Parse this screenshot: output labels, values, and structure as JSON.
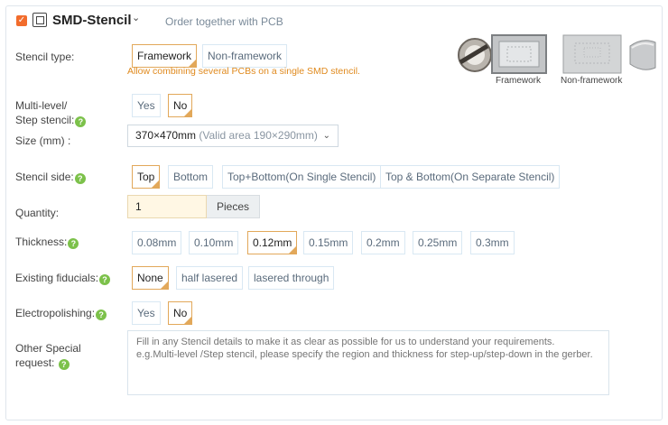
{
  "header": {
    "title": "SMD-Stencil",
    "subtitle": "Order together with PCB"
  },
  "stencil_type": {
    "label": "Stencil type:",
    "options": [
      "Framework",
      "Non-framework"
    ],
    "selected": "Framework",
    "hint": "Allow combining several PCBs on a single SMD stencil.",
    "image_captions": [
      "Framework",
      "Non-framework"
    ]
  },
  "multi_level": {
    "label_line1": "Multi-level/",
    "label_line2": "Step stencil:",
    "options": [
      "Yes",
      "No"
    ],
    "selected": "No"
  },
  "size": {
    "label": "Size (mm) :",
    "value": "370×470mm",
    "valid_area": "(Valid area 190×290mm)"
  },
  "stencil_side": {
    "label": "Stencil side:",
    "options": [
      "Top",
      "Bottom",
      "Top+Bottom(On Single Stencil)",
      "Top & Bottom(On Separate Stencil)"
    ],
    "selected": "Top"
  },
  "quantity": {
    "label": "Quantity:",
    "value": "1",
    "unit": "Pieces"
  },
  "thickness": {
    "label": "Thickness:",
    "options": [
      "0.08mm",
      "0.10mm",
      "0.12mm",
      "0.15mm",
      "0.2mm",
      "0.25mm",
      "0.3mm"
    ],
    "selected": "0.12mm"
  },
  "fiducials": {
    "label": "Existing fiducials:",
    "options": [
      "None",
      "half lasered",
      "lasered through"
    ],
    "selected": "None"
  },
  "electropolishing": {
    "label": "Electropolishing:",
    "options": [
      "Yes",
      "No"
    ],
    "selected": "No"
  },
  "special_request": {
    "label_line1": "Other Special",
    "label_line2": "request:",
    "placeholder": "Fill in any Stencil details to make it as clear as possible for us to understand your requirements.\ne.g.Multi-level /Step stencil, please specify the region and thickness for step-up/step-down in the gerber."
  },
  "colors": {
    "accent": "#f26c2c",
    "selected_border": "#e2a85a",
    "help_icon": "#7cc14a",
    "hint_text": "#e08a1e"
  },
  "icons": [
    "checkbox-checked-icon",
    "stencil-chip-icon",
    "chevron-down-icon",
    "help-icon"
  ]
}
